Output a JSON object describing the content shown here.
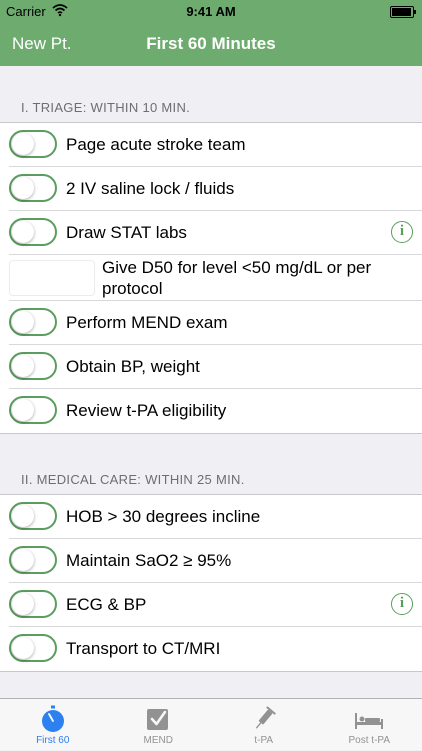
{
  "status_bar": {
    "carrier": "Carrier",
    "time": "9:41 AM",
    "battery_level": 0.95
  },
  "nav": {
    "back_label": "New Pt.",
    "title": "First 60 Minutes"
  },
  "sections": [
    {
      "header": "I. TRIAGE: WITHIN 10 MIN.",
      "items": [
        {
          "label": "Page acute stroke team",
          "control": "toggle",
          "on": false,
          "info": false
        },
        {
          "label": "2 IV saline lock / fluids",
          "control": "toggle",
          "on": false,
          "info": false
        },
        {
          "label": "Draw STAT labs",
          "control": "toggle",
          "on": false,
          "info": true
        },
        {
          "label": "Give D50 for level <50 mg/dL or per protocol",
          "control": "box",
          "on": false,
          "info": false
        },
        {
          "label": "Perform MEND exam",
          "control": "toggle",
          "on": false,
          "info": false
        },
        {
          "label": "Obtain BP, weight",
          "control": "toggle",
          "on": false,
          "info": false
        },
        {
          "label": "Review t-PA eligibility",
          "control": "toggle",
          "on": false,
          "info": false
        }
      ]
    },
    {
      "header": "II. MEDICAL CARE: WITHIN 25 MIN.",
      "items": [
        {
          "label": "HOB > 30 degrees incline",
          "control": "toggle",
          "on": false,
          "info": false
        },
        {
          "label": "Maintain SaO2 ≥ 95%",
          "control": "toggle",
          "on": false,
          "info": false
        },
        {
          "label": "ECG & BP",
          "control": "toggle",
          "on": false,
          "info": true
        },
        {
          "label": "Transport to CT/MRI",
          "control": "toggle",
          "on": false,
          "info": false
        }
      ]
    }
  ],
  "info_glyph": "i",
  "tabs": [
    {
      "label": "First 60",
      "icon": "stopwatch-icon",
      "active": true
    },
    {
      "label": "MEND",
      "icon": "checklist-icon",
      "active": false
    },
    {
      "label": "t-PA",
      "icon": "syringe-icon",
      "active": false
    },
    {
      "label": "Post t-PA",
      "icon": "hospital-bed-icon",
      "active": false
    }
  ],
  "colors": {
    "nav_green": "#6dab6f",
    "toggle_green": "#5a9d5e",
    "tab_active": "#2d80f0",
    "tab_inactive": "#929292"
  }
}
